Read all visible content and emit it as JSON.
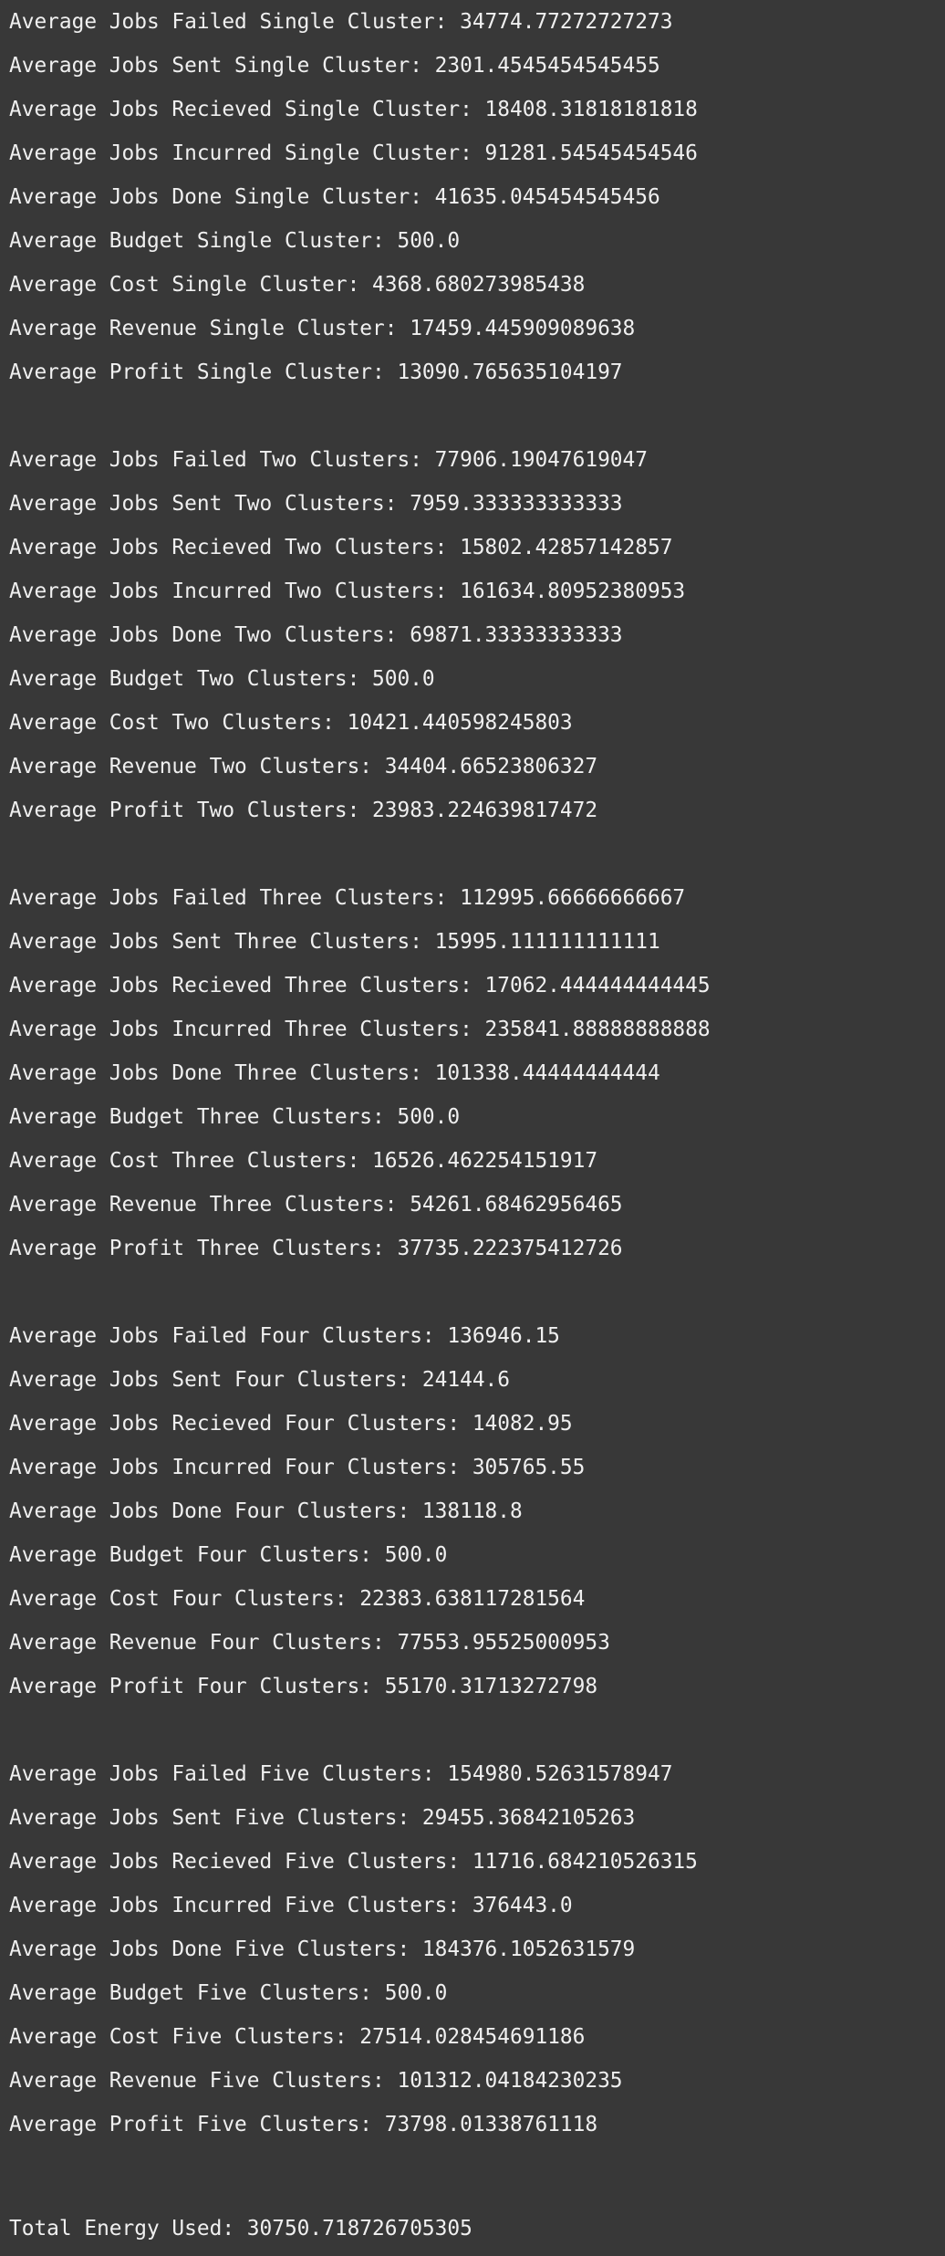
{
  "output": {
    "blocks": [
      {
        "lines": [
          "Average Jobs Failed Single Cluster: 34774.77272727273",
          "Average Jobs Sent Single Cluster: 2301.4545454545455",
          "Average Jobs Recieved Single Cluster: 18408.31818181818",
          "Average Jobs Incurred Single Cluster: 91281.54545454546",
          "Average Jobs Done Single Cluster: 41635.045454545456",
          "Average Budget Single Cluster: 500.0",
          "Average Cost Single Cluster: 4368.680273985438",
          "Average Revenue Single Cluster: 17459.445909089638",
          "Average Profit Single Cluster: 13090.765635104197"
        ]
      },
      {
        "lines": [
          "Average Jobs Failed Two Clusters: 77906.19047619047",
          "Average Jobs Sent Two Clusters: 7959.333333333333",
          "Average Jobs Recieved Two Clusters: 15802.42857142857",
          "Average Jobs Incurred Two Clusters: 161634.80952380953",
          "Average Jobs Done Two Clusters: 69871.33333333333",
          "Average Budget Two Clusters: 500.0",
          "Average Cost Two Clusters: 10421.440598245803",
          "Average Revenue Two Clusters: 34404.66523806327",
          "Average Profit Two Clusters: 23983.224639817472"
        ]
      },
      {
        "lines": [
          "Average Jobs Failed Three Clusters: 112995.66666666667",
          "Average Jobs Sent Three Clusters: 15995.111111111111",
          "Average Jobs Recieved Three Clusters: 17062.444444444445",
          "Average Jobs Incurred Three Clusters: 235841.88888888888",
          "Average Jobs Done Three Clusters: 101338.44444444444",
          "Average Budget Three Clusters: 500.0",
          "Average Cost Three Clusters: 16526.462254151917",
          "Average Revenue Three Clusters: 54261.68462956465",
          "Average Profit Three Clusters: 37735.222375412726"
        ]
      },
      {
        "lines": [
          "Average Jobs Failed Four Clusters: 136946.15",
          "Average Jobs Sent Four Clusters: 24144.6",
          "Average Jobs Recieved Four Clusters: 14082.95",
          "Average Jobs Incurred Four Clusters: 305765.55",
          "Average Jobs Done Four Clusters: 138118.8",
          "Average Budget Four Clusters: 500.0",
          "Average Cost Four Clusters: 22383.638117281564",
          "Average Revenue Four Clusters: 77553.95525000953",
          "Average Profit Four Clusters: 55170.31713272798"
        ]
      },
      {
        "lines": [
          "Average Jobs Failed Five Clusters: 154980.52631578947",
          "Average Jobs Sent Five Clusters: 29455.36842105263",
          "Average Jobs Recieved Five Clusters: 11716.684210526315",
          "Average Jobs Incurred Five Clusters: 376443.0",
          "Average Jobs Done Five Clusters: 184376.1052631579",
          "Average Budget Five Clusters: 500.0",
          "Average Cost Five Clusters: 27514.028454691186",
          "Average Revenue Five Clusters: 101312.04184230235",
          "Average Profit Five Clusters: 73798.01338761118"
        ]
      }
    ],
    "total_line": "Total Energy Used: 30750.718726705305"
  },
  "colors": {
    "background": "#383838",
    "text": "#f0f0f0"
  }
}
